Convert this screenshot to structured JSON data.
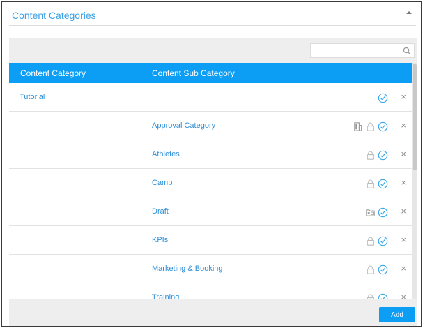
{
  "panel": {
    "title": "Content Categories"
  },
  "search": {
    "placeholder": "",
    "value": ""
  },
  "grid": {
    "columns": {
      "category": "Content Category",
      "sub_category": "Content Sub Category"
    },
    "rows": [
      {
        "category": "Tutorial",
        "sub_category": "",
        "icons": [
          "check-circle-icon"
        ]
      },
      {
        "category": "",
        "sub_category": "Approval Category",
        "icons": [
          "form-icon",
          "lock-icon",
          "check-circle-icon"
        ]
      },
      {
        "category": "",
        "sub_category": "Athletes",
        "icons": [
          "lock-icon",
          "check-circle-icon"
        ]
      },
      {
        "category": "",
        "sub_category": "Camp",
        "icons": [
          "lock-icon",
          "check-circle-icon"
        ]
      },
      {
        "category": "",
        "sub_category": "Draft",
        "icons": [
          "folder-icon",
          "check-circle-icon"
        ]
      },
      {
        "category": "",
        "sub_category": "KPIs",
        "icons": [
          "lock-icon",
          "check-circle-icon"
        ]
      },
      {
        "category": "",
        "sub_category": "Marketing & Booking",
        "icons": [
          "lock-icon",
          "check-circle-icon"
        ]
      },
      {
        "category": "",
        "sub_category": "Training",
        "icons": [
          "lock-icon",
          "check-circle-icon"
        ]
      }
    ],
    "close_glyph": "×"
  },
  "footer": {
    "add_label": "Add"
  },
  "colors": {
    "accent": "#0c9ef5",
    "link": "#2d8fd8"
  }
}
